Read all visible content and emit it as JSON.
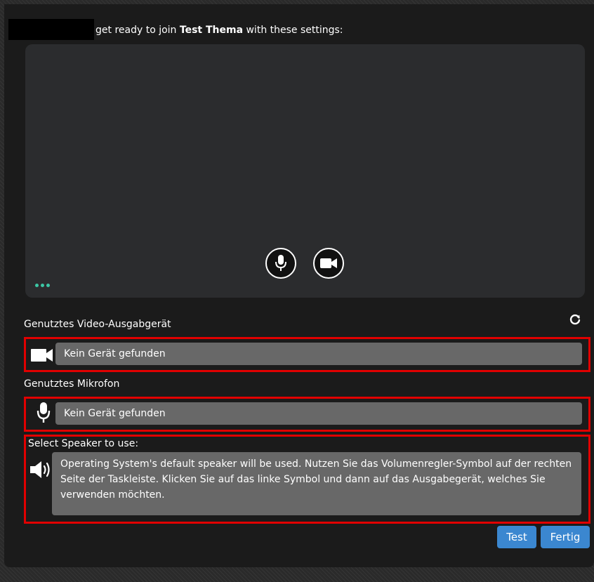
{
  "header": {
    "prefix": "get ready to join",
    "meeting_name": "Test Thema",
    "suffix": "with these settings:"
  },
  "video": {
    "label": "Genutztes Video-Ausgabgerät",
    "value": "Kein Gerät gefunden"
  },
  "microphone": {
    "label": "Genutztes Mikrofon",
    "value": "Kein Gerät gefunden"
  },
  "speaker": {
    "label": "Select Speaker to use:",
    "value": "Operating System's default speaker will be used. Nutzen Sie das Volumenregler-Symbol auf der rechten Seite der Taskleiste. Klicken Sie auf das linke Symbol und dann auf das Ausgabegerät, welches Sie verwenden möchten."
  },
  "buttons": {
    "test": "Test",
    "done": "Fertig"
  },
  "colors": {
    "accent": "#3b87d0",
    "highlight": "#e10000",
    "loading_dots": "#3cc7a5"
  }
}
